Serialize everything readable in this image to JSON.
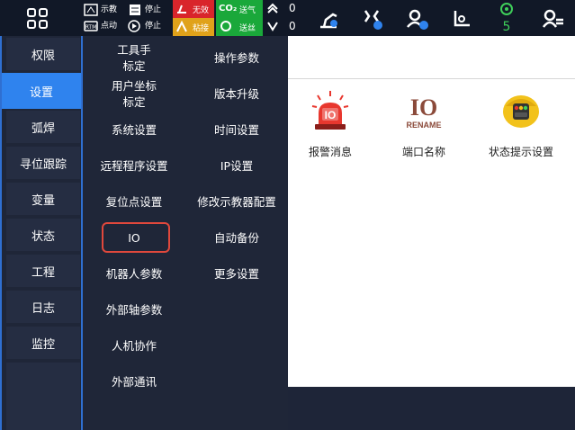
{
  "topbar": {
    "mode_teach": "示教",
    "mode_jog": "点动",
    "stop_1": "停止",
    "stop_2": "停止",
    "invalid": "无效",
    "stick": "粘接",
    "co2": "CO₂",
    "gas_feed": "送气",
    "wire_feed": "送丝",
    "value_up": "0",
    "value_down": "0",
    "speed_value": "5",
    "colors": {
      "red": "#d9252b",
      "yellow": "#e0a21a",
      "green": "#1aa83a",
      "accent": "#2f83ee"
    },
    "icons": [
      "grid-menu-icon",
      "robot-arm-icon",
      "gripper-icon",
      "user-icon",
      "coordinate-icon",
      "tool-icon",
      "user-settings-icon"
    ]
  },
  "nav": {
    "items": [
      "权限",
      "设置",
      "弧焊",
      "寻位跟踪",
      "变量",
      "状态",
      "工程",
      "日志",
      "监控"
    ],
    "active": "设置"
  },
  "submenu": {
    "left": [
      "工具手\n标定",
      "用户坐标\n标定",
      "系统设置",
      "远程程序设置",
      "复位点设置",
      "IO",
      "机器人参数",
      "外部轴参数",
      "人机协作",
      "外部通讯"
    ],
    "right": [
      "操作参数",
      "版本升级",
      "时间设置",
      "IP设置",
      "修改示教器配置",
      "自动备份",
      "更多设置"
    ],
    "highlighted": "IO"
  },
  "main": {
    "tiles": [
      {
        "label": "报警消息",
        "icon": "alarm-light-icon",
        "icon_text": "IO"
      },
      {
        "label": "端口名称",
        "icon": "io-rename-icon",
        "icon_text": "IO",
        "icon_subtext": "RENAME"
      },
      {
        "label": "状态提示设置",
        "icon": "traffic-light-icon"
      }
    ]
  }
}
